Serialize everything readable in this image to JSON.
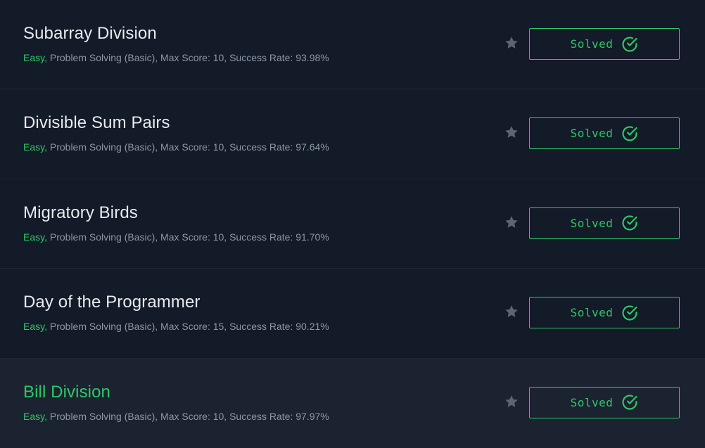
{
  "colors": {
    "background": "#131a28",
    "hover_background": "#1c2330",
    "accent_green": "#2ec866",
    "title_text": "#e8ebf0",
    "meta_text": "#8d97a7",
    "star_icon": "#5d6572"
  },
  "challenges": [
    {
      "title": "Subarray Division",
      "difficulty": "Easy,",
      "details": " Problem Solving (Basic), Max Score: 10, Success Rate: 93.98%",
      "status_label": "Solved",
      "hovered": false
    },
    {
      "title": "Divisible Sum Pairs",
      "difficulty": "Easy,",
      "details": " Problem Solving (Basic), Max Score: 10, Success Rate: 97.64%",
      "status_label": "Solved",
      "hovered": false
    },
    {
      "title": "Migratory Birds",
      "difficulty": "Easy,",
      "details": " Problem Solving (Basic), Max Score: 10, Success Rate: 91.70%",
      "status_label": "Solved",
      "hovered": false
    },
    {
      "title": "Day of the Programmer",
      "difficulty": "Easy,",
      "details": " Problem Solving (Basic), Max Score: 15, Success Rate: 90.21%",
      "status_label": "Solved",
      "hovered": false
    },
    {
      "title": "Bill Division",
      "difficulty": "Easy,",
      "details": " Problem Solving (Basic), Max Score: 10, Success Rate: 97.97%",
      "status_label": "Solved",
      "hovered": true
    }
  ],
  "icons": {
    "bookmark": "star-icon",
    "status": "check-circle-icon"
  }
}
